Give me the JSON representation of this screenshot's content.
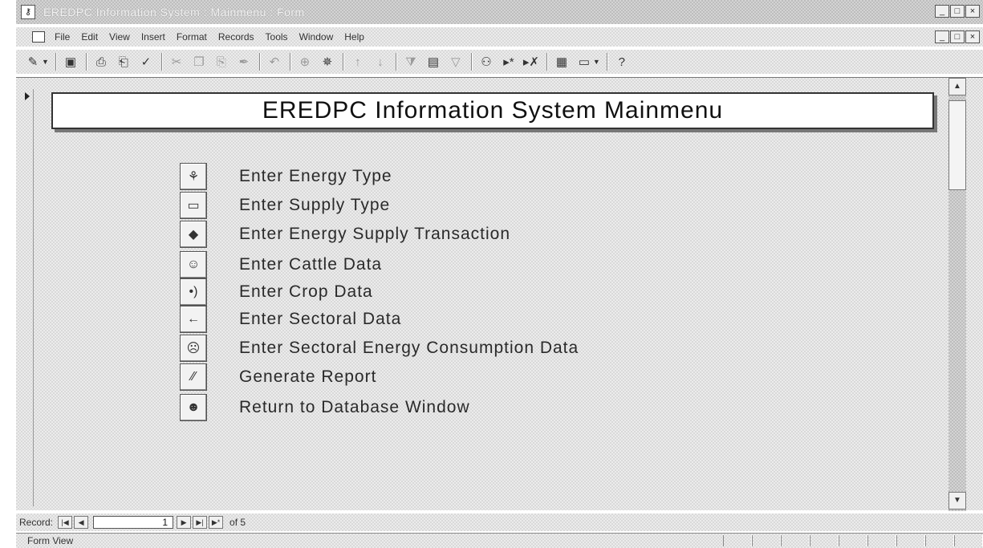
{
  "window": {
    "title": "EREDPC Information System : Mainmenu : Form",
    "buttons": [
      "_",
      "□",
      "×"
    ]
  },
  "menubar": {
    "items": [
      "File",
      "Edit",
      "View",
      "Insert",
      "Format",
      "Records",
      "Tools",
      "Window",
      "Help"
    ],
    "doc_buttons": [
      "_",
      "□",
      "×"
    ]
  },
  "toolbar": {
    "buttons": [
      {
        "icon": "design-view-icon",
        "glyph": "✎"
      },
      {
        "icon": "save-icon",
        "glyph": "▣"
      },
      {
        "icon": "print-icon",
        "glyph": "⎙"
      },
      {
        "icon": "print-preview-icon",
        "glyph": "⎗"
      },
      {
        "icon": "spelling-icon",
        "glyph": "✓"
      },
      {
        "icon": "cut-icon",
        "glyph": "✂"
      },
      {
        "icon": "copy-icon",
        "glyph": "❐"
      },
      {
        "icon": "paste-icon",
        "glyph": "⎘"
      },
      {
        "icon": "format-painter-icon",
        "glyph": "✒"
      },
      {
        "icon": "undo-icon",
        "glyph": "↶"
      },
      {
        "icon": "hyperlink-icon",
        "glyph": "⊕"
      },
      {
        "icon": "web-toolbar-icon",
        "glyph": "✵"
      },
      {
        "icon": "sort-ascending-icon",
        "glyph": "↑"
      },
      {
        "icon": "sort-descending-icon",
        "glyph": "↓"
      },
      {
        "icon": "filter-by-selection-icon",
        "glyph": "⧩"
      },
      {
        "icon": "filter-by-form-icon",
        "glyph": "▤"
      },
      {
        "icon": "apply-filter-icon",
        "glyph": "▽"
      },
      {
        "icon": "find-icon",
        "glyph": "⚇"
      },
      {
        "icon": "new-record-icon",
        "glyph": "▸*"
      },
      {
        "icon": "delete-record-icon",
        "glyph": "▸✗"
      },
      {
        "icon": "database-window-icon",
        "glyph": "▦"
      },
      {
        "icon": "new-object-icon",
        "glyph": "▭"
      },
      {
        "icon": "help-icon",
        "glyph": "?"
      }
    ]
  },
  "form": {
    "title": "EREDPC Information System Mainmenu",
    "menu": [
      {
        "label": "Enter Energy Type",
        "icon": "energy-type-icon",
        "glyph": "⚘"
      },
      {
        "label": "Enter Supply Type",
        "icon": "supply-type-icon",
        "glyph": "▭"
      },
      {
        "label": "Enter Energy Supply Transaction",
        "icon": "transaction-icon",
        "glyph": "◆"
      },
      {
        "label": "Enter Cattle Data",
        "icon": "cattle-icon",
        "glyph": "☺"
      },
      {
        "label": "Enter Crop Data",
        "icon": "crop-icon",
        "glyph": "•)"
      },
      {
        "label": "Enter Sectoral Data",
        "icon": "arrow-left-icon",
        "glyph": "←"
      },
      {
        "label": "Enter Sectoral Energy Consumption Data",
        "icon": "consumption-icon",
        "glyph": "☹"
      },
      {
        "label": "Generate Report",
        "icon": "report-icon",
        "glyph": "∕∕"
      },
      {
        "label": "Return to Database Window",
        "icon": "return-icon",
        "glyph": "☻"
      }
    ]
  },
  "record_nav": {
    "label": "Record:",
    "current": "1",
    "of_label": "of 5",
    "buttons": {
      "first": "|◀",
      "prev": "◀",
      "next": "▶",
      "last": "▶|",
      "new": "▶*"
    }
  },
  "statusbar": {
    "text": "Form View"
  }
}
